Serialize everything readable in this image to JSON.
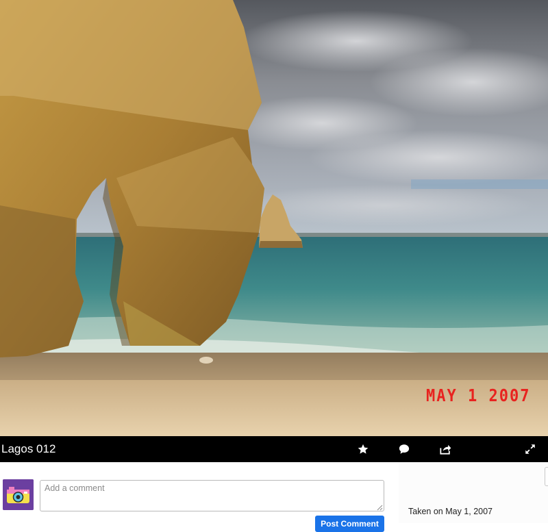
{
  "photo": {
    "date_stamp": "MAY 1 2007",
    "description": "Photo"
  },
  "caption_bar": {
    "title": "Lagos 012",
    "icons": [
      "star-icon",
      "comment-icon",
      "share-icon",
      "fullscreen-icon"
    ]
  },
  "comments": {
    "placeholder": "Add a comment",
    "post_label": "Post Comment"
  },
  "details": {
    "taken_on": "Taken on May 1, 2007"
  },
  "colors": {
    "caption_bar_bg": "#000000",
    "post_button_bg": "#1a73e8",
    "date_stamp": "#e8231f",
    "avatar_bg": "#6b3fa0"
  }
}
